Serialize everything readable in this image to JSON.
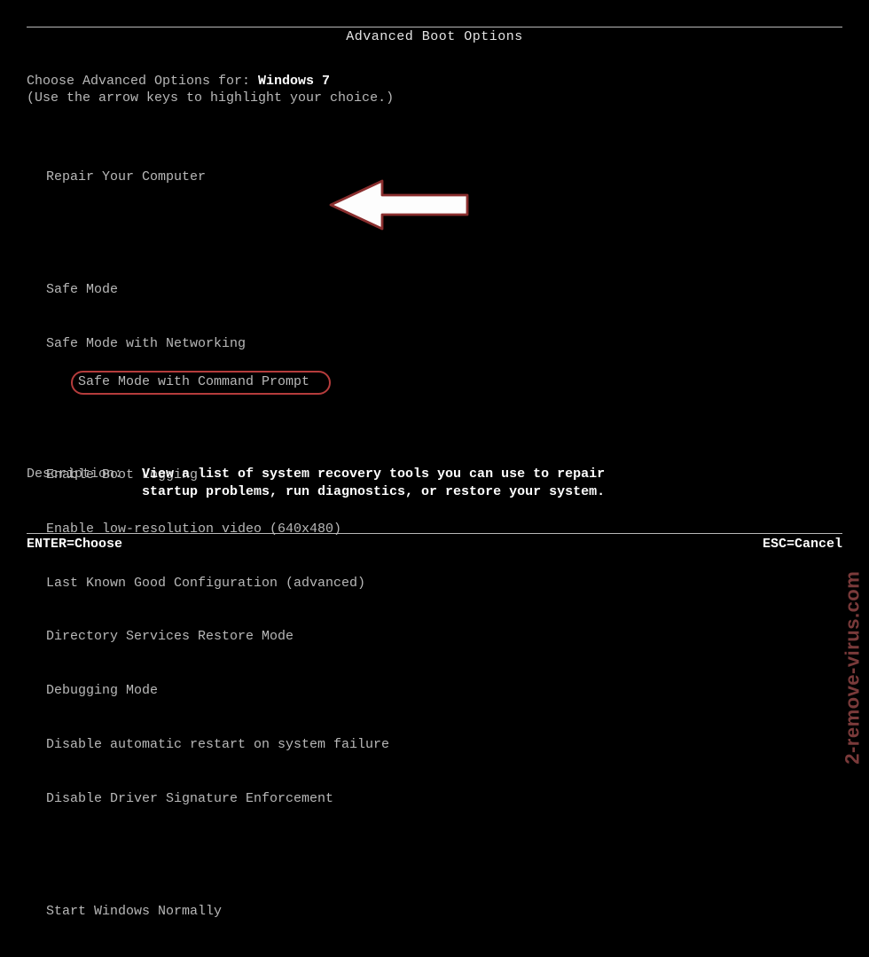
{
  "title": "Advanced Boot Options",
  "choose": {
    "prefix": "Choose Advanced Options for: ",
    "os": "Windows 7",
    "sub": "(Use the arrow keys to highlight your choice.)"
  },
  "menu": {
    "repair": "Repair Your Computer",
    "safe": "Safe Mode",
    "safe_net": "Safe Mode with Networking",
    "safe_cmd": "Safe Mode with Command Prompt",
    "boot_log": "Enable Boot Logging",
    "lowres": "Enable low-resolution video (640x480)",
    "lkgc": "Last Known Good Configuration (advanced)",
    "dsrm": "Directory Services Restore Mode",
    "debug": "Debugging Mode",
    "no_restart": "Disable automatic restart on system failure",
    "no_sig": "Disable Driver Signature Enforcement",
    "normal": "Start Windows Normally"
  },
  "description": {
    "label": "Description:",
    "line1": "View a list of system recovery tools you can use to repair",
    "line2": "startup problems, run diagnostics, or restore your system."
  },
  "footer": {
    "enter": "ENTER=Choose",
    "esc": "ESC=Cancel"
  },
  "watermark": "2-remove-virus.com"
}
